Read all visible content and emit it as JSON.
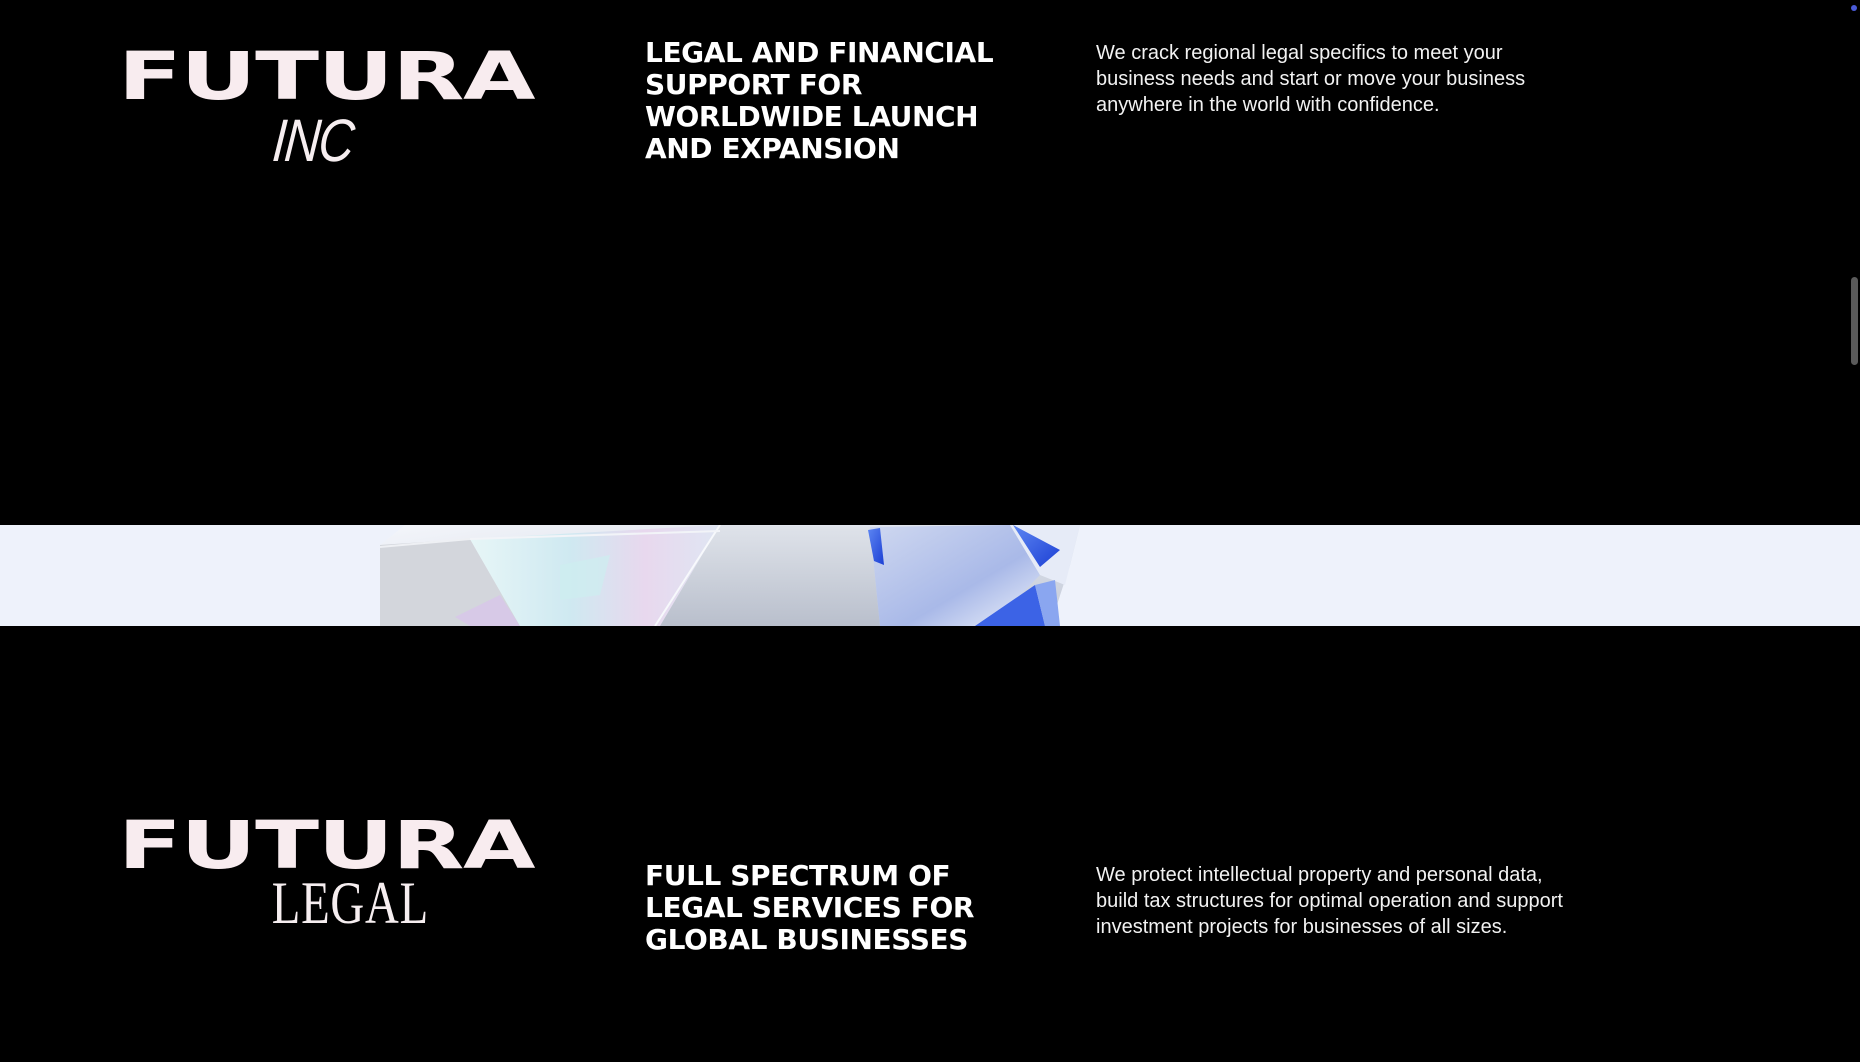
{
  "sections": [
    {
      "logo_word": "FUTURA",
      "logo_sub": "INC",
      "heading": "LEGAL AND FINANCIAL SUPPORT FOR WORLDWIDE LAUNCH AND EXPANSION",
      "description": "We crack regional legal specifics to meet your business needs and start or move your business anywhere in the world with confidence."
    },
    {
      "logo_word": "FUTURA",
      "logo_sub": "LEGAL",
      "heading": "FULL SPECTRUM OF LEGAL SERVICES FOR GLOBAL BUSINESSES",
      "description": "We protect intellectual property and personal data, build tax structures for optimal operation and support investment projects for businesses of all sizes."
    }
  ],
  "colors": {
    "background": "#000000",
    "band": "#eef2fb",
    "logo": "#f8ecef",
    "accent_blue": "#1f4fe0"
  },
  "icons": {
    "crystal": "crystal-prism-image"
  }
}
